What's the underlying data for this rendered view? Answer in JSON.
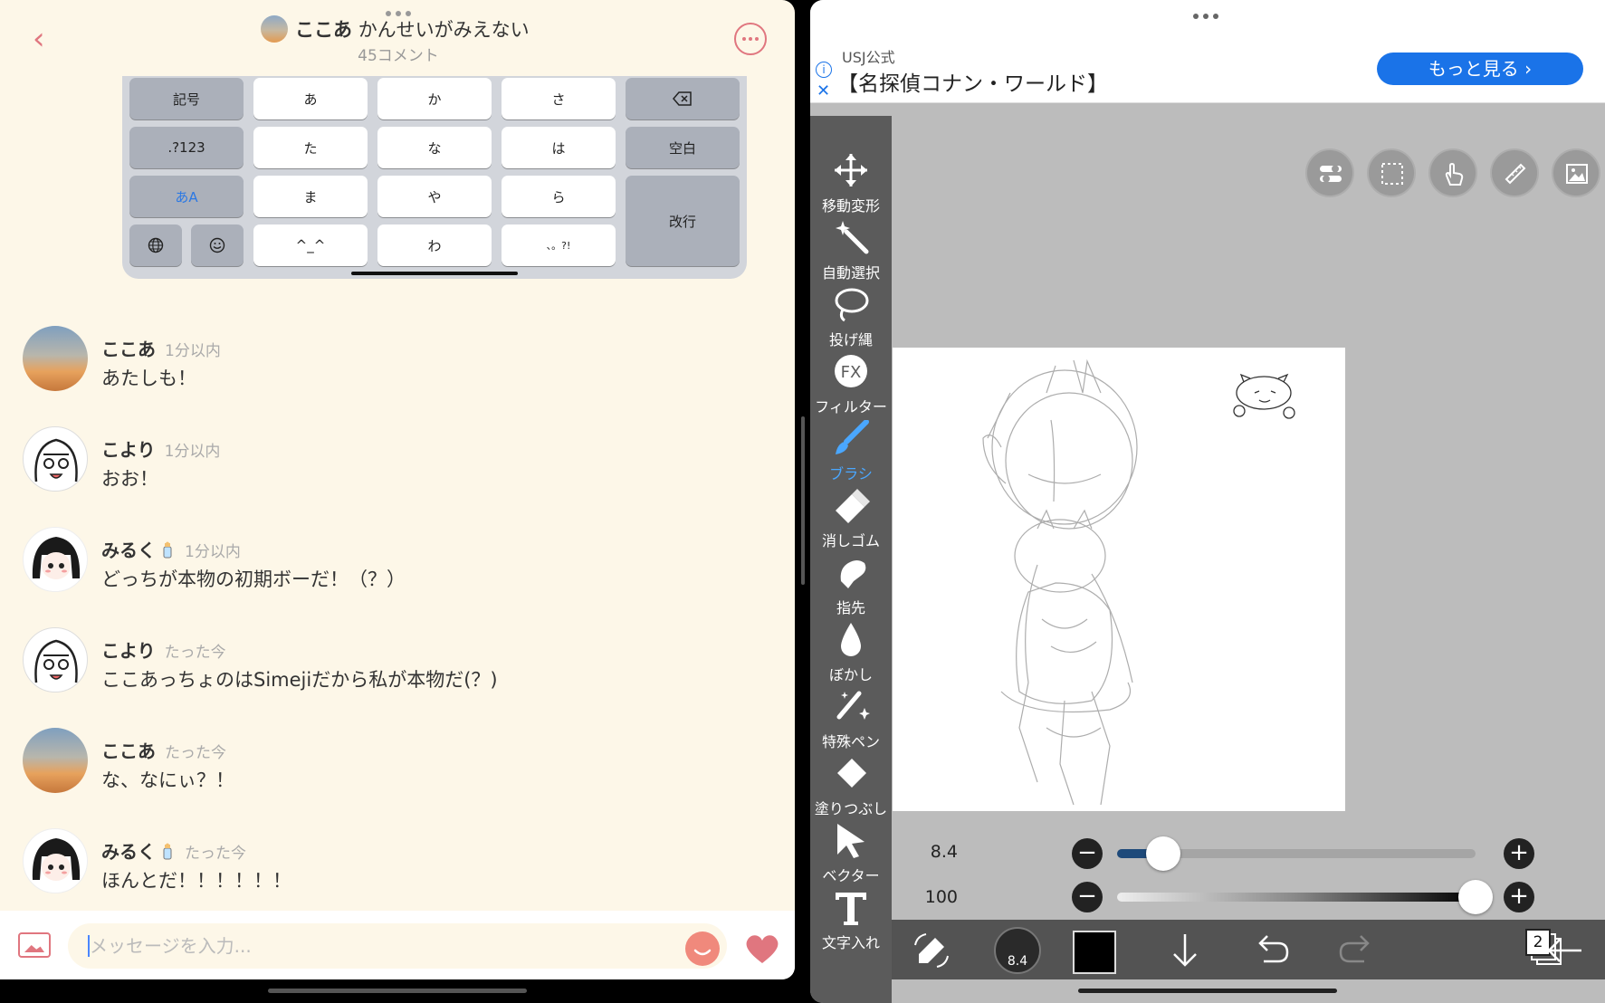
{
  "left": {
    "header": {
      "title_name": "ここあ",
      "title_text": "かんせいがみえない",
      "subtitle": "45コメント"
    },
    "keyboard": {
      "row1": [
        "記号",
        "あ",
        "か",
        "さ"
      ],
      "row2": [
        ".?123",
        "た",
        "な",
        "は",
        "空白"
      ],
      "row3": [
        "あA",
        "ま",
        "や",
        "ら",
        "改行"
      ],
      "row4": [
        "^_^",
        "わ",
        "、。?!"
      ]
    },
    "messages": [
      {
        "name": "ここあ",
        "time": "1分以内",
        "text": "あたしも！",
        "avatar": "sky"
      },
      {
        "name": "こより",
        "time": "1分以内",
        "text": "おお！",
        "avatar": "koyori"
      },
      {
        "name": "みるく",
        "time": "1分以内",
        "text": "どっちが本物の初期ボーだ！（？）",
        "avatar": "miruku"
      },
      {
        "name": "こより",
        "time": "たった今",
        "text": "ここあっちょのはSimejiだから私が本物だ(？)",
        "avatar": "koyori"
      },
      {
        "name": "ここあ",
        "time": "たった今",
        "text": "な、なにぃ？！",
        "avatar": "sky"
      },
      {
        "name": "みるく",
        "time": "たった今",
        "text": "ほんとだ！！！！！！",
        "avatar": "miruku"
      }
    ],
    "input": {
      "placeholder": "メッセージを入力..."
    }
  },
  "right": {
    "ad": {
      "source": "USJ公式",
      "title": "【名探偵コナン・ワールド】",
      "button": "もっと見る"
    },
    "tools": [
      {
        "label": "移動変形",
        "icon": "move-icon"
      },
      {
        "label": "自動選択",
        "icon": "magic-wand-icon"
      },
      {
        "label": "投げ縄",
        "icon": "lasso-icon"
      },
      {
        "label": "フィルター",
        "icon": "fx-icon"
      },
      {
        "label": "ブラシ",
        "icon": "brush-icon",
        "active": true
      },
      {
        "label": "消しゴム",
        "icon": "eraser-icon"
      },
      {
        "label": "指先",
        "icon": "finger-icon"
      },
      {
        "label": "ぼかし",
        "icon": "blur-icon"
      },
      {
        "label": "特殊ペン",
        "icon": "special-pen-icon"
      },
      {
        "label": "塗りつぶし",
        "icon": "fill-icon"
      },
      {
        "label": "ベクター",
        "icon": "vector-icon"
      },
      {
        "label": "文字入れ",
        "icon": "text-icon"
      }
    ],
    "brush_size": {
      "value": "8.4",
      "fraction": 0.13
    },
    "opacity": {
      "value": "100",
      "fraction": 1.0
    },
    "bottom": {
      "brush_size_label": "8.4",
      "layer_count": "2"
    },
    "colors": {
      "accent": "#4aa7ff",
      "primary_color": "#000000"
    }
  }
}
